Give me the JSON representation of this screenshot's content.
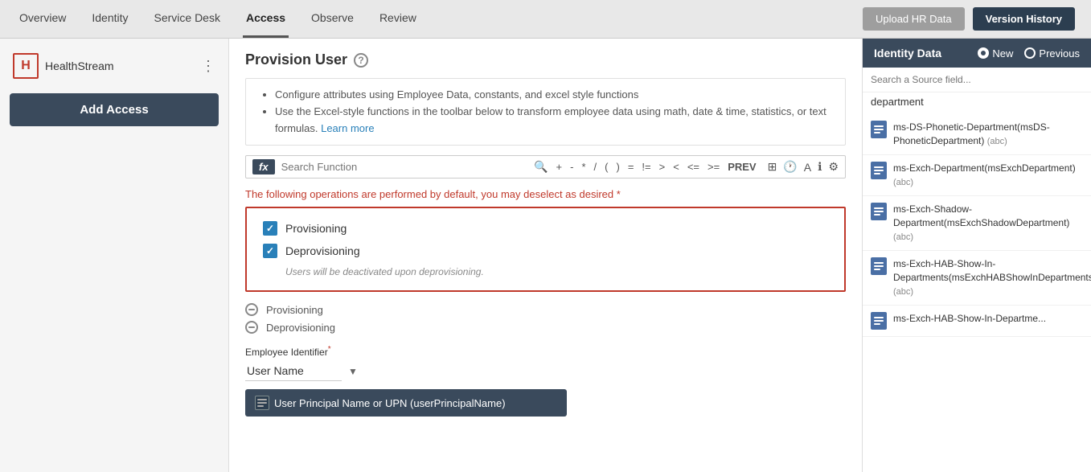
{
  "topNav": {
    "items": [
      {
        "label": "Overview",
        "active": false
      },
      {
        "label": "Identity",
        "active": false
      },
      {
        "label": "Service Desk",
        "active": false
      },
      {
        "label": "Access",
        "active": true
      },
      {
        "label": "Observe",
        "active": false
      },
      {
        "label": "Review",
        "active": false
      }
    ],
    "uploadBtn": "Upload HR Data",
    "versionBtn": "Version History"
  },
  "sidebar": {
    "brandLogo": "H",
    "brandName": "HealthStream",
    "addAccessBtn": "Add Access"
  },
  "main": {
    "title": "Provision User",
    "infoBullets": [
      "Configure attributes using Employee Data, constants, and excel style functions",
      "Use the Excel-style functions in the toolbar below to transform employee data using math, date & time, statistics, or text formulas."
    ],
    "learnMore": "Learn more",
    "formulaBar": {
      "fx": "fx",
      "placeholder": "Search Function",
      "ops": [
        "+",
        "-",
        "*",
        "/",
        "(",
        ")",
        "=",
        "!=",
        ">",
        "<",
        "<=",
        ">=",
        "PREV"
      ]
    },
    "opsLabel": "The following operations are performed by default, you may deselect as desired *",
    "operations": [
      {
        "label": "Provisioning",
        "checked": true
      },
      {
        "label": "Deprovisioning",
        "checked": true
      }
    ],
    "deprovisioningNote": "Users will be deactivated upon deprovisioning.",
    "circleItems": [
      "Provisioning",
      "Deprovisioning"
    ],
    "employeeIdLabel": "Employee Identifier",
    "employeeIdRequired": true,
    "employeeIdValue": "User Name",
    "upnText": "User Principal Name or UPN (userPrincipalName)"
  },
  "rightPanel": {
    "title": "Identity Data",
    "radioNew": "New",
    "radioPrevious": "Previous",
    "searchPlaceholder": "Search a Source field...",
    "searchValue": "department",
    "sources": [
      {
        "name": "ms-DS-Phonetic-Department(msDS-PhoneticDepartment)",
        "type": "abc"
      },
      {
        "name": "ms-Exch-Department(msExchDepartment)",
        "type": "abc"
      },
      {
        "name": "ms-Exch-Shadow-Department(msExchShadowDepartment)",
        "type": "abc"
      },
      {
        "name": "ms-Exch-HAB-Show-In-Departments(msExchHABShowInDepartments)",
        "type": "abc"
      },
      {
        "name": "ms-Exch-HAB-Show-In-Departme...",
        "type": ""
      }
    ]
  }
}
